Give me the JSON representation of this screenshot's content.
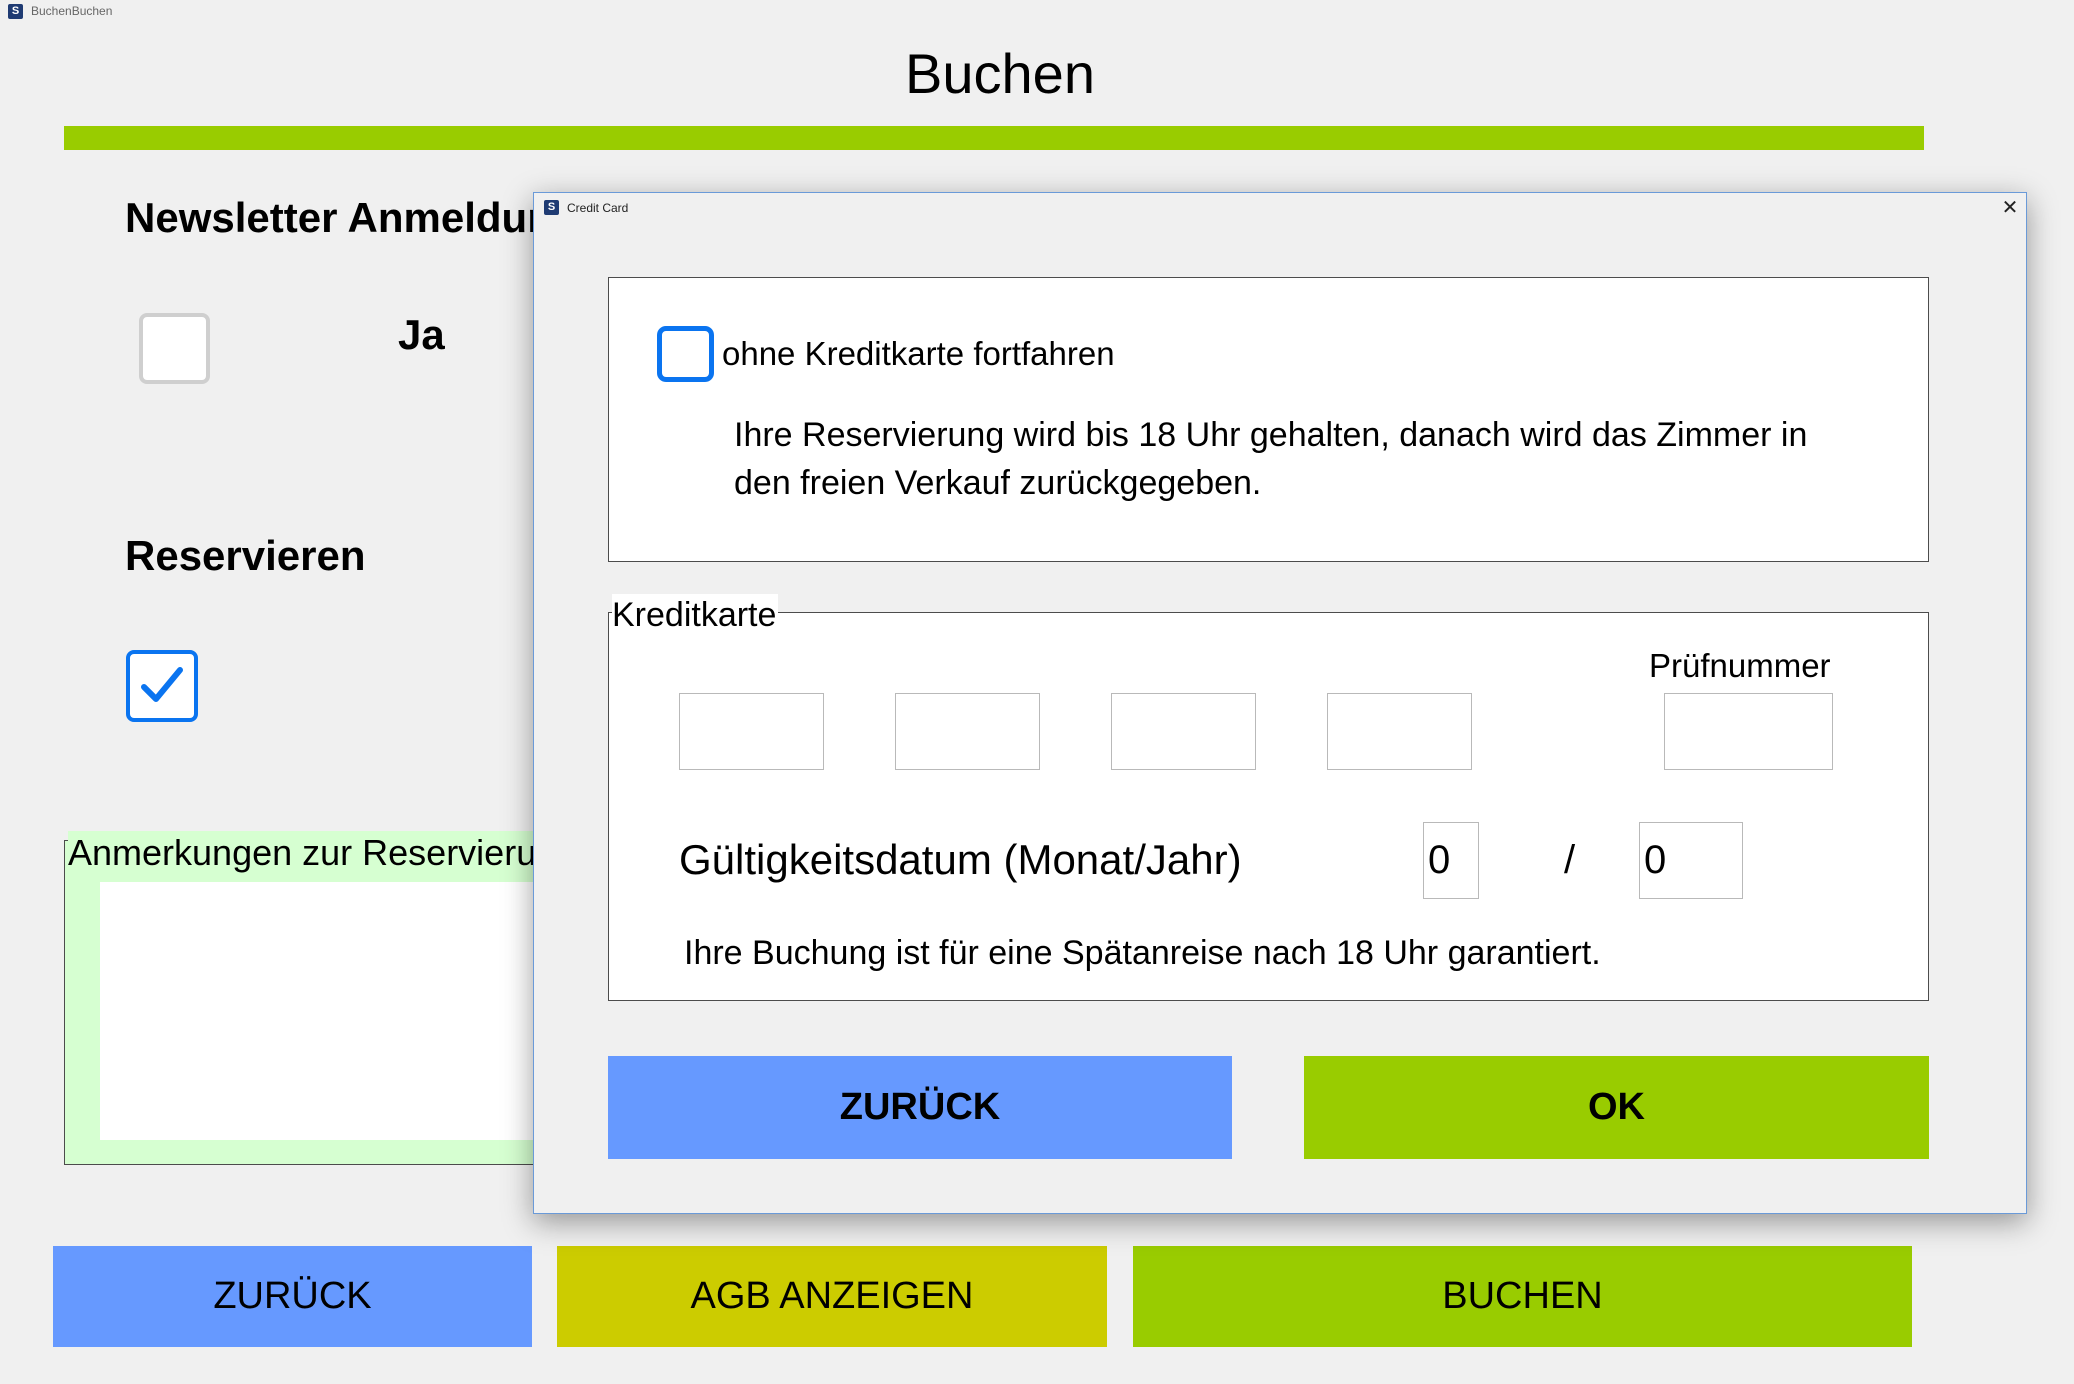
{
  "window": {
    "title": "BuchenBuchen",
    "icon": "app-icon"
  },
  "page": {
    "title": "Buchen"
  },
  "newsletter": {
    "heading": "Newsletter Anmeldung",
    "yes_label": "Ja",
    "checked": false
  },
  "reserve": {
    "heading": "Reservieren",
    "checked": true
  },
  "notes": {
    "legend": "Anmerkungen zur Reservierung",
    "value": ""
  },
  "buttons": {
    "back": "ZURÜCK",
    "terms": "AGB ANZEIGEN",
    "book": "BUCHEN"
  },
  "colors": {
    "accent_green": "#99cc00",
    "button_blue": "#6699ff",
    "button_yellow": "#cccc00",
    "notes_bg": "#d6ffd1",
    "checkbox_blue": "#0a74f0"
  },
  "dialog": {
    "title": "Credit Card",
    "close_icon": "close-icon",
    "no_card": {
      "label": "ohne Kreditkarte fortfahren",
      "checked": false,
      "info": "Ihre Reservierung wird bis 18 Uhr gehalten, danach wird das Zimmer in den freien Verkauf zurückgegeben."
    },
    "card": {
      "legend": "Kreditkarte",
      "cvc_label": "Prüfnummer",
      "number_parts": [
        "",
        "",
        "",
        ""
      ],
      "cvc": "",
      "validity_label": "Gültigkeitsdatum (Monat/Jahr)",
      "month": "0",
      "separator": "/",
      "year": "0",
      "guarantee": "Ihre Buchung ist für eine Spätanreise nach 18 Uhr garantiert."
    },
    "buttons": {
      "back": "ZURÜCK",
      "ok": "OK"
    }
  }
}
